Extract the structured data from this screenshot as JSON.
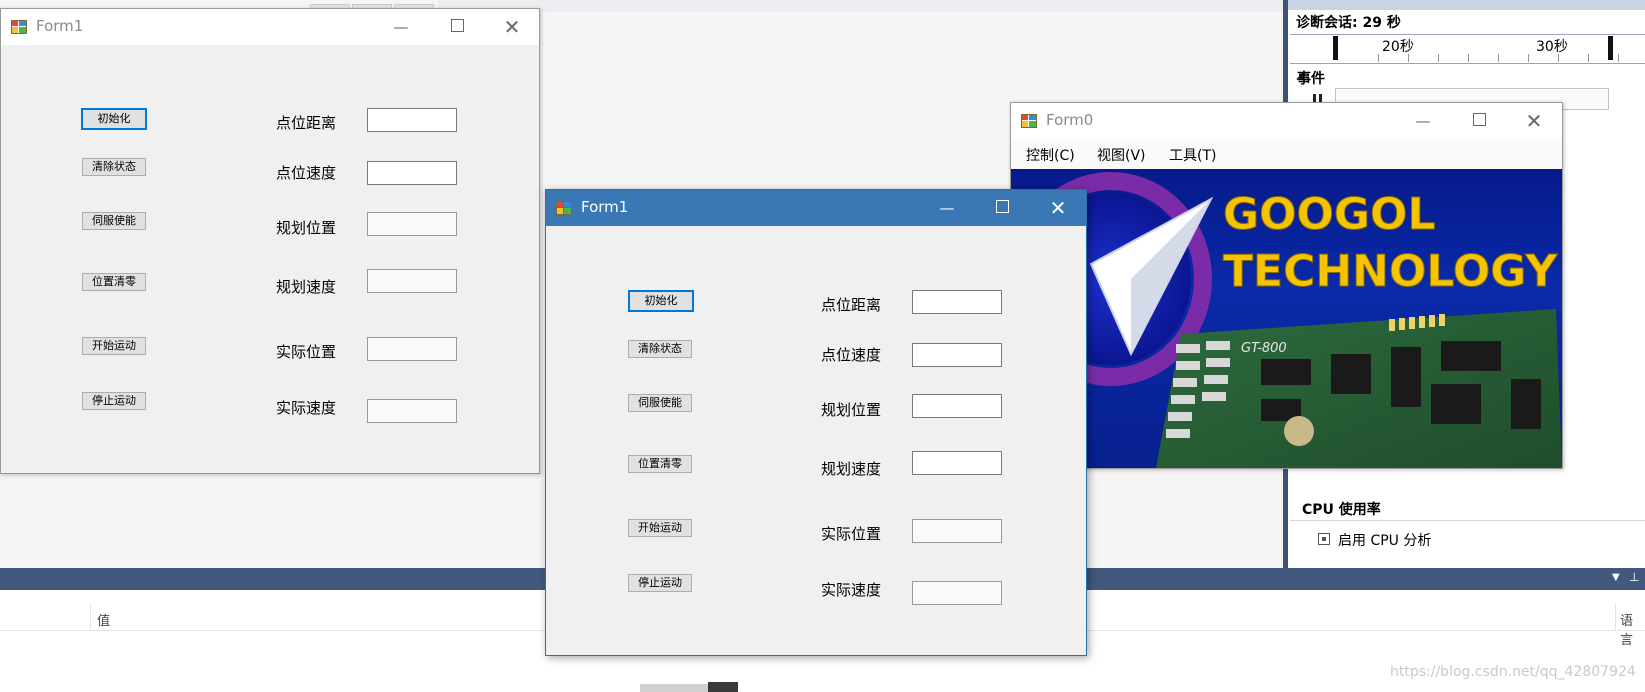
{
  "vs": {
    "diag_session": "诊断会话: 29 秒",
    "timeline_20": "20秒",
    "timeline_30": "30秒",
    "events_header": "事件",
    "cpu_header": "CPU 使用率",
    "cpu_enable": "启用 CPU 分析",
    "grid_col_value": "值",
    "grid_col_lang": "语言",
    "watermark": "https://blog.csdn.net/qq_42807924"
  },
  "form1": {
    "title": "Form1",
    "buttons": {
      "init": "初始化",
      "clear_status": "清除状态",
      "servo_enable": "伺服使能",
      "position_zero": "位置清零",
      "start_motion": "开始运动",
      "stop_motion": "停止运动"
    },
    "labels": {
      "point_distance": "点位距离",
      "point_speed": "点位速度",
      "plan_position": "规划位置",
      "plan_speed": "规划速度",
      "actual_position": "实际位置",
      "actual_speed": "实际速度"
    }
  },
  "form0": {
    "title": "Form0",
    "menu": {
      "control": "控制(C)",
      "view": "视图(V)",
      "tools": "工具(T)"
    },
    "banner": {
      "line1": "GOOGOL",
      "line2": "TECHNOLOGY",
      "board_label": "GT-800"
    }
  },
  "colors": {
    "vs_accent": "#42587c",
    "active_titlebar": "#3a78b5",
    "default_button_border": "#0078d7",
    "banner_blue": "#0a2aa8",
    "banner_text": "#f5c400"
  }
}
